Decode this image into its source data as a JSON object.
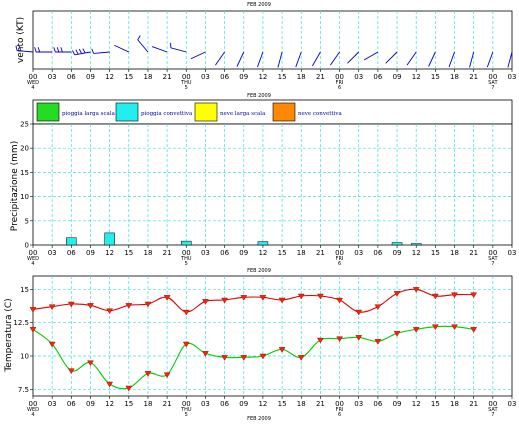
{
  "time_axis": {
    "hour_labels": [
      "00",
      "03",
      "06",
      "09",
      "12",
      "15",
      "18",
      "21",
      "00",
      "03",
      "06",
      "09",
      "12",
      "15",
      "18",
      "21",
      "00",
      "03",
      "06",
      "09",
      "12",
      "15",
      "18",
      "21",
      "00",
      "03"
    ],
    "day_labels": [
      {
        "index": 0,
        "day": "WED",
        "num": "4"
      },
      {
        "index": 8,
        "day": "THU",
        "num": "5"
      },
      {
        "index": 16,
        "day": "FRI",
        "num": "6"
      },
      {
        "index": 24,
        "day": "SAT",
        "num": "7"
      }
    ],
    "month_label": "FEB 2009"
  },
  "legend": {
    "items": [
      {
        "label": "pioggia larga scala",
        "color": "#22dd22"
      },
      {
        "label": "pioggia convettiva",
        "color": "#22eeee"
      },
      {
        "label": "neve larga scala",
        "color": "#ffff00"
      },
      {
        "label": "neve convettiva",
        "color": "#ff8800"
      }
    ]
  },
  "chart_data": [
    {
      "type": "scatter",
      "ylabel": "vento (KT)",
      "x_hours": [
        0,
        3,
        6,
        9,
        12,
        15,
        18,
        21,
        24,
        27,
        30,
        33,
        36,
        39,
        42,
        45,
        48,
        51,
        54,
        57,
        60,
        63,
        66,
        69,
        72,
        75
      ],
      "wind_direction_deg": [
        275,
        270,
        270,
        260,
        265,
        295,
        320,
        290,
        285,
        245,
        215,
        205,
        200,
        195,
        200,
        210,
        215,
        225,
        240,
        225,
        215,
        205,
        200,
        195,
        200,
        195
      ],
      "wind_barb_flags": [
        2,
        2,
        3,
        4,
        1,
        0,
        1,
        0,
        1,
        0,
        0,
        0,
        0,
        0,
        0,
        0,
        0,
        0,
        0,
        0,
        0,
        0,
        0,
        0,
        0,
        0
      ]
    },
    {
      "type": "bar",
      "ylabel": "Precipitazione (mm)",
      "ylim": [
        0,
        25
      ],
      "yticks": [
        0,
        5,
        10,
        15,
        20,
        25
      ],
      "grid": true,
      "series": [
        {
          "name": "pioggia convettiva",
          "x_hours": [
            6,
            12,
            24,
            36,
            57,
            60
          ],
          "values": [
            1.5,
            2.5,
            0.8,
            0.7,
            0.5,
            0.3
          ]
        }
      ]
    },
    {
      "type": "line",
      "ylabel": "Temperatura (C)",
      "ylim": [
        7.0,
        16.0
      ],
      "yticks": [
        7.5,
        10,
        12.5,
        15
      ],
      "grid": true,
      "x_hours": [
        0,
        3,
        6,
        9,
        12,
        15,
        18,
        21,
        24,
        27,
        30,
        33,
        36,
        39,
        42,
        45,
        48,
        51,
        54,
        57,
        60,
        63,
        66,
        69,
        72,
        75
      ],
      "series": [
        {
          "values": [
            13.5,
            13.7,
            13.9,
            13.8,
            13.4,
            13.8,
            13.9,
            14.4,
            13.3,
            14.1,
            14.2,
            14.4,
            14.4,
            14.2,
            14.5,
            14.5,
            14.2,
            13.3,
            13.7,
            14.7,
            15.0,
            14.5,
            14.6,
            14.6,
            null,
            null
          ],
          "color": "#dd0000"
        },
        {
          "values": [
            12.0,
            10.9,
            8.9,
            9.5,
            7.9,
            7.6,
            8.7,
            8.6,
            10.9,
            10.2,
            9.9,
            9.9,
            10.0,
            10.5,
            9.9,
            11.2,
            11.3,
            11.4,
            11.1,
            11.7,
            12.0,
            12.2,
            12.2,
            12.0,
            null,
            null
          ],
          "color": "#00cc00"
        }
      ]
    }
  ]
}
